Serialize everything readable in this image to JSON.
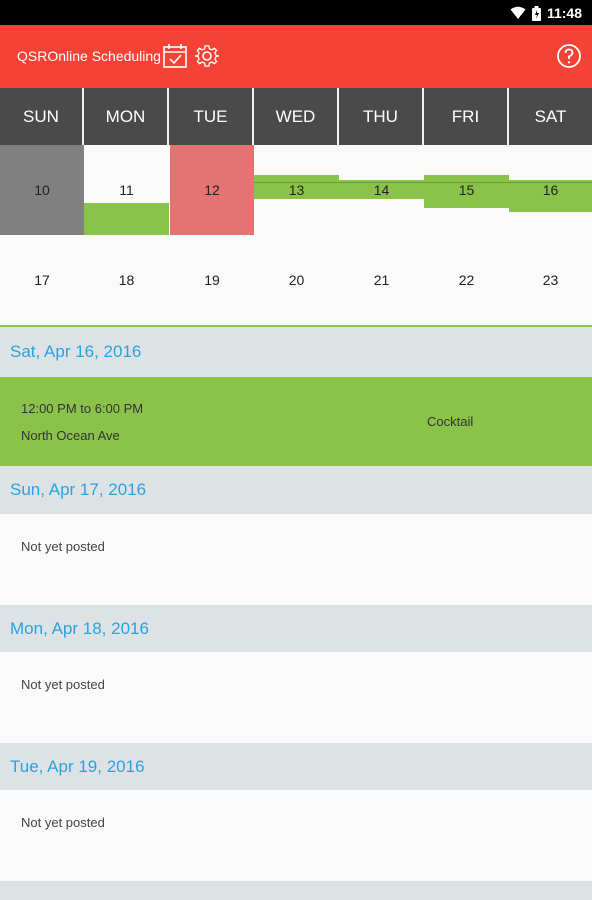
{
  "status_bar": {
    "time": "11:48",
    "icons": [
      "wifi-icon",
      "battery-icon"
    ]
  },
  "app_bar": {
    "title": "QSROnline Scheduling",
    "color": "#f44336",
    "icons": [
      "calendar-check-icon",
      "gear-icon",
      "help-icon"
    ]
  },
  "calendar": {
    "days": [
      "SUN",
      "MON",
      "TUE",
      "WED",
      "THU",
      "FRI",
      "SAT"
    ],
    "week1": [
      "10",
      "11",
      "12",
      "13",
      "14",
      "15",
      "16"
    ],
    "week2": [
      "17",
      "18",
      "19",
      "20",
      "21",
      "22",
      "23"
    ]
  },
  "schedule": {
    "sat": {
      "date": "Sat, Apr 16, 2016",
      "time": "12:00 PM to 6:00 PM",
      "location": "North Ocean Ave",
      "role": "Cocktail"
    },
    "sun": {
      "date": "Sun, Apr 17, 2016",
      "status": "Not yet posted"
    },
    "mon": {
      "date": "Mon, Apr 18, 2016",
      "status": "Not yet posted"
    },
    "tue": {
      "date": "Tue, Apr 19, 2016",
      "status": "Not yet posted"
    }
  },
  "colors": {
    "shift": "#8bc34a",
    "past_day": "#808080",
    "today": "#e57373",
    "date_text": "#29a3e0",
    "header_bg": "#4a4a4a"
  }
}
